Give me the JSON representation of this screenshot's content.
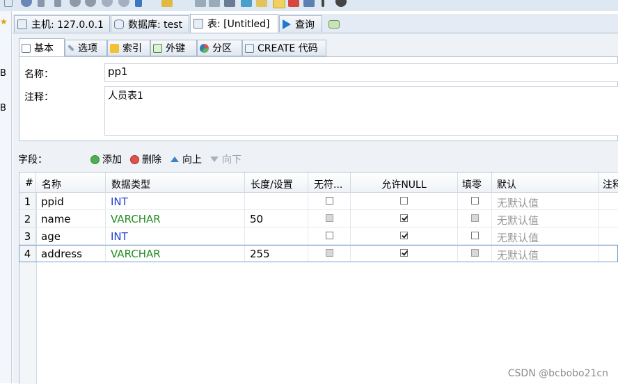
{
  "left_strip": {
    "letters": [
      "B",
      "B"
    ]
  },
  "tabs": [
    {
      "label": "主机: 127.0.0.1",
      "icon": "server-icon"
    },
    {
      "label": "数据库: test",
      "icon": "database-icon"
    },
    {
      "label": "表: [Untitled]",
      "icon": "table-icon",
      "active": true
    },
    {
      "label": "查询",
      "icon": "play-query-icon"
    }
  ],
  "subtabs": [
    {
      "label": "基本",
      "icon": "basic-icon",
      "active": true
    },
    {
      "label": "选项",
      "icon": "wrench-icon"
    },
    {
      "label": "索引",
      "icon": "lightning-icon"
    },
    {
      "label": "外键",
      "icon": "foreign-key-icon"
    },
    {
      "label": "分区",
      "icon": "partition-icon"
    },
    {
      "label": "CREATE 代码",
      "icon": "code-icon"
    }
  ],
  "form": {
    "name_label": "名称：",
    "name_value": "pp1",
    "comment_label": "注释：",
    "comment_value": "人员表1"
  },
  "fields_bar": {
    "label": "字段：",
    "add": "添加",
    "delete": "删除",
    "up": "向上",
    "down": "向下"
  },
  "grid": {
    "headers": [
      "#",
      "名称",
      "数据类型",
      "长度/设置",
      "无符...",
      "允许NULL",
      "填零",
      "默认",
      "注释"
    ],
    "rows": [
      {
        "num": "1",
        "name": "ppid",
        "type": "INT",
        "type_color": "#1f3fd6",
        "length": "",
        "unsigned": {
          "checked": false,
          "disabled": false
        },
        "allow_null": {
          "checked": false,
          "disabled": false
        },
        "zerofill": {
          "checked": false,
          "disabled": false
        },
        "default": "无默认值"
      },
      {
        "num": "2",
        "name": "name",
        "type": "VARCHAR",
        "type_color": "#228b22",
        "length": "50",
        "unsigned": {
          "checked": false,
          "disabled": true
        },
        "allow_null": {
          "checked": true,
          "disabled": false
        },
        "zerofill": {
          "checked": false,
          "disabled": true
        },
        "default": "无默认值"
      },
      {
        "num": "3",
        "name": "age",
        "type": "INT",
        "type_color": "#1f3fd6",
        "length": "",
        "unsigned": {
          "checked": false,
          "disabled": false
        },
        "allow_null": {
          "checked": true,
          "disabled": false
        },
        "zerofill": {
          "checked": false,
          "disabled": false
        },
        "default": "无默认值"
      },
      {
        "num": "4",
        "name": "address",
        "type": "VARCHAR",
        "type_color": "#228b22",
        "length": "255",
        "unsigned": {
          "checked": false,
          "disabled": true
        },
        "allow_null": {
          "checked": true,
          "disabled": false
        },
        "zerofill": {
          "checked": false,
          "disabled": true
        },
        "default": "无默认值"
      }
    ]
  },
  "watermark": "CSDN @bcbobo21cn"
}
